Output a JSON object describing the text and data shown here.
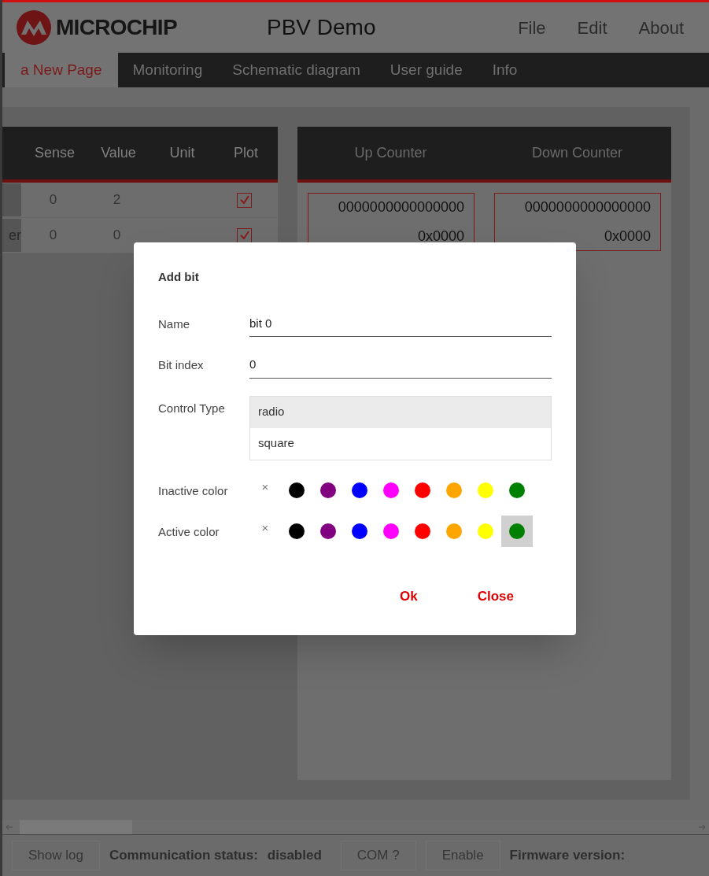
{
  "header": {
    "logo_text": "MICROCHIP",
    "title": "PBV Demo",
    "menu": [
      "File",
      "Edit",
      "About"
    ]
  },
  "tabs": [
    {
      "label": "a New Page",
      "selected": true
    },
    {
      "label": "Monitoring",
      "selected": false
    },
    {
      "label": "Schematic diagram",
      "selected": false
    },
    {
      "label": "User guide",
      "selected": false
    },
    {
      "label": "Info",
      "selected": false
    }
  ],
  "table": {
    "columns": [
      "Sense",
      "Value",
      "Unit",
      "Plot"
    ],
    "rows": [
      {
        "name": "",
        "sense": "0",
        "value": "2",
        "unit": "",
        "plot": true
      },
      {
        "name": "er",
        "sense": "0",
        "value": "0",
        "unit": "",
        "plot": true
      }
    ]
  },
  "counters": [
    {
      "title": "Up Counter",
      "binary": "0000000000000000",
      "hex": "0x0000"
    },
    {
      "title": "Down Counter",
      "binary": "0000000000000000",
      "hex": "0x0000"
    }
  ],
  "dialog": {
    "title": "Add bit",
    "fields": [
      {
        "label": "Name",
        "value": "bit 0"
      },
      {
        "label": "Bit index",
        "value": "0"
      }
    ],
    "control_type": {
      "label": "Control Type",
      "options": [
        {
          "label": "radio",
          "selected": true
        },
        {
          "label": "square",
          "selected": false
        }
      ]
    },
    "color_rows": [
      {
        "label": "Inactive color",
        "none": {
          "label": "×",
          "selected": false
        },
        "swatches": [
          {
            "color": "#000000",
            "selected": false
          },
          {
            "color": "#800080",
            "selected": false
          },
          {
            "color": "#0000ff",
            "selected": false
          },
          {
            "color": "#ff00ff",
            "selected": false
          },
          {
            "color": "#ff0000",
            "selected": false
          },
          {
            "color": "#ffa500",
            "selected": false
          },
          {
            "color": "#ffff00",
            "selected": false
          },
          {
            "color": "#008000",
            "selected": false
          }
        ]
      },
      {
        "label": "Active color",
        "none": {
          "label": "×",
          "selected": false
        },
        "swatches": [
          {
            "color": "#000000",
            "selected": false
          },
          {
            "color": "#800080",
            "selected": false
          },
          {
            "color": "#0000ff",
            "selected": false
          },
          {
            "color": "#ff00ff",
            "selected": false
          },
          {
            "color": "#ff0000",
            "selected": false
          },
          {
            "color": "#ffa500",
            "selected": false
          },
          {
            "color": "#ffff00",
            "selected": false
          },
          {
            "color": "#008000",
            "selected": true
          }
        ]
      }
    ],
    "buttons": [
      "Ok",
      "Close"
    ]
  },
  "status_bar": {
    "show_log": "Show log",
    "comm_label": "Communication status:",
    "comm_value": "disabled",
    "com_button": "COM ?",
    "enable_button": "Enable",
    "firmware_label": "Firmware version:"
  }
}
